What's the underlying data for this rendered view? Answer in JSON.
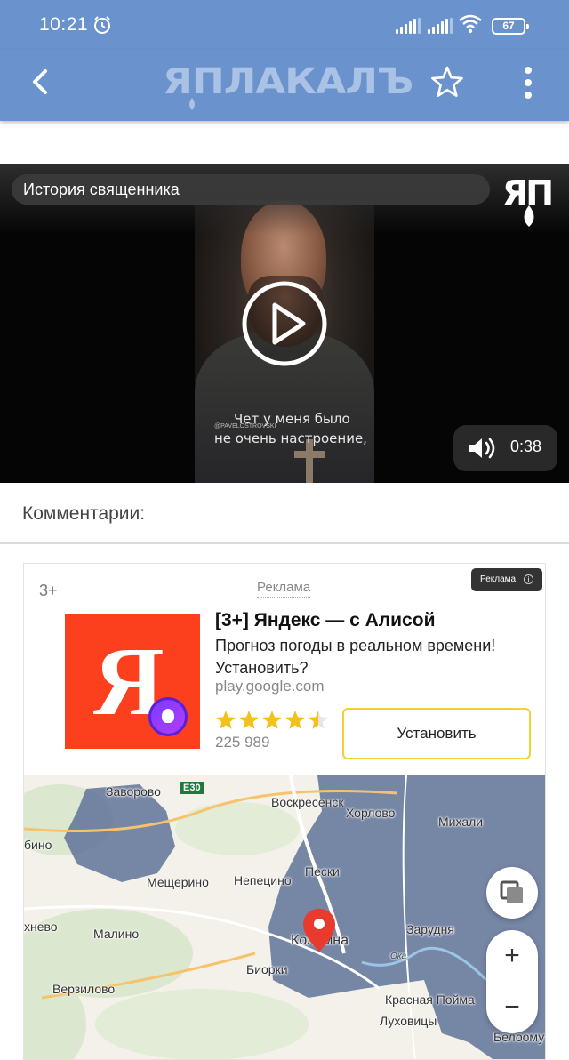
{
  "status_bar": {
    "time": "10:21",
    "battery": "67"
  },
  "app_bar": {
    "logo_text": "ЯПЛАКАЛЪ",
    "accent_color": "#6a93cd"
  },
  "video": {
    "title": "История священника",
    "watermark": "ЯП",
    "caption_handle": "@PAVELOSTROVSKI",
    "caption_line1": "Чет у меня было",
    "caption_line2": "не очень настроение,",
    "duration": "0:38"
  },
  "comments": {
    "heading": "Комментарии:"
  },
  "ad": {
    "age_rating": "3+",
    "label": "Реклама",
    "badge": "Реклама",
    "title": "[3+] Яндекс — с Алисой",
    "description": "Прогноз погоды в реальном времени! Установить?",
    "domain": "play.google.com",
    "rating": 4.5,
    "reviews": "225 989",
    "install_label": "Установить",
    "icon_letter": "Я",
    "icon_color": "#fc3f1d"
  },
  "map": {
    "road_badge": "E30",
    "labels": [
      "Заворово",
      "Воскресенск",
      "Хорлово",
      "Михали",
      "бино",
      "Пески",
      "Мещерино",
      "Непецино",
      "хнево",
      "Малино",
      "Зарудня",
      "Коломна",
      "Биорки",
      "Верзилово",
      "Красная Пойма",
      "Луховицы",
      "Белоомут",
      "Ока"
    ],
    "zoom_in": "+",
    "zoom_out": "−",
    "weather_overlay_color": "#5a6e96"
  }
}
